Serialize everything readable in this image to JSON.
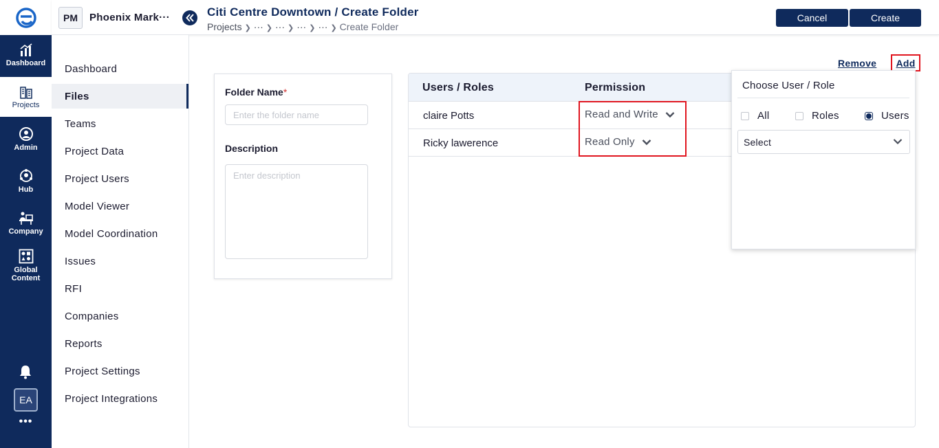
{
  "rail": {
    "items": [
      {
        "label": "Dashboard",
        "icon": "chart-icon"
      },
      {
        "label": "Projects",
        "icon": "building-icon"
      },
      {
        "label": "Admin",
        "icon": "admin-icon"
      },
      {
        "label": "Hub",
        "icon": "hub-icon"
      },
      {
        "label": "Company",
        "icon": "company-icon"
      },
      {
        "label": "Global Content",
        "icon": "global-content-icon"
      }
    ],
    "avatar": "EA",
    "more": "•••"
  },
  "header": {
    "project_badge": "PM",
    "project_name": "Phoenix Mark···",
    "title": "Citi Centre Downtown / Create Folder",
    "breadcrumb": {
      "root": "Projects",
      "ellipsis": "···",
      "current": "Create Folder"
    },
    "cancel_label": "Cancel",
    "create_label": "Create"
  },
  "sidenav": {
    "items": [
      "Dashboard",
      "Files",
      "Teams",
      "Project Data",
      "Project Users",
      "Model Viewer",
      "Model Coordination",
      "Issues",
      "RFI",
      "Companies",
      "Reports",
      "Project Settings",
      "Project Integrations"
    ],
    "active": "Files"
  },
  "form": {
    "folder_name_label": "Folder Name",
    "required_mark": "*",
    "folder_name_placeholder": "Enter the folder name",
    "description_label": "Description",
    "description_placeholder": "Enter description"
  },
  "actions": {
    "remove": "Remove",
    "add": "Add"
  },
  "table": {
    "headers": [
      "Users / Roles",
      "Permission"
    ],
    "rows": [
      {
        "user": "claire Potts",
        "permission": "Read and Write"
      },
      {
        "user": "Ricky lawerence",
        "permission": "Read Only"
      }
    ]
  },
  "popover": {
    "title": "Choose User / Role",
    "options": [
      {
        "label": "All",
        "checked": false
      },
      {
        "label": "Roles",
        "checked": false
      },
      {
        "label": "Users",
        "checked": true
      }
    ],
    "select_value": "Select"
  },
  "colors": {
    "brand_navy": "#0f2a5c",
    "highlight_red": "#e0141e",
    "table_header_bg": "#eef3fa"
  }
}
